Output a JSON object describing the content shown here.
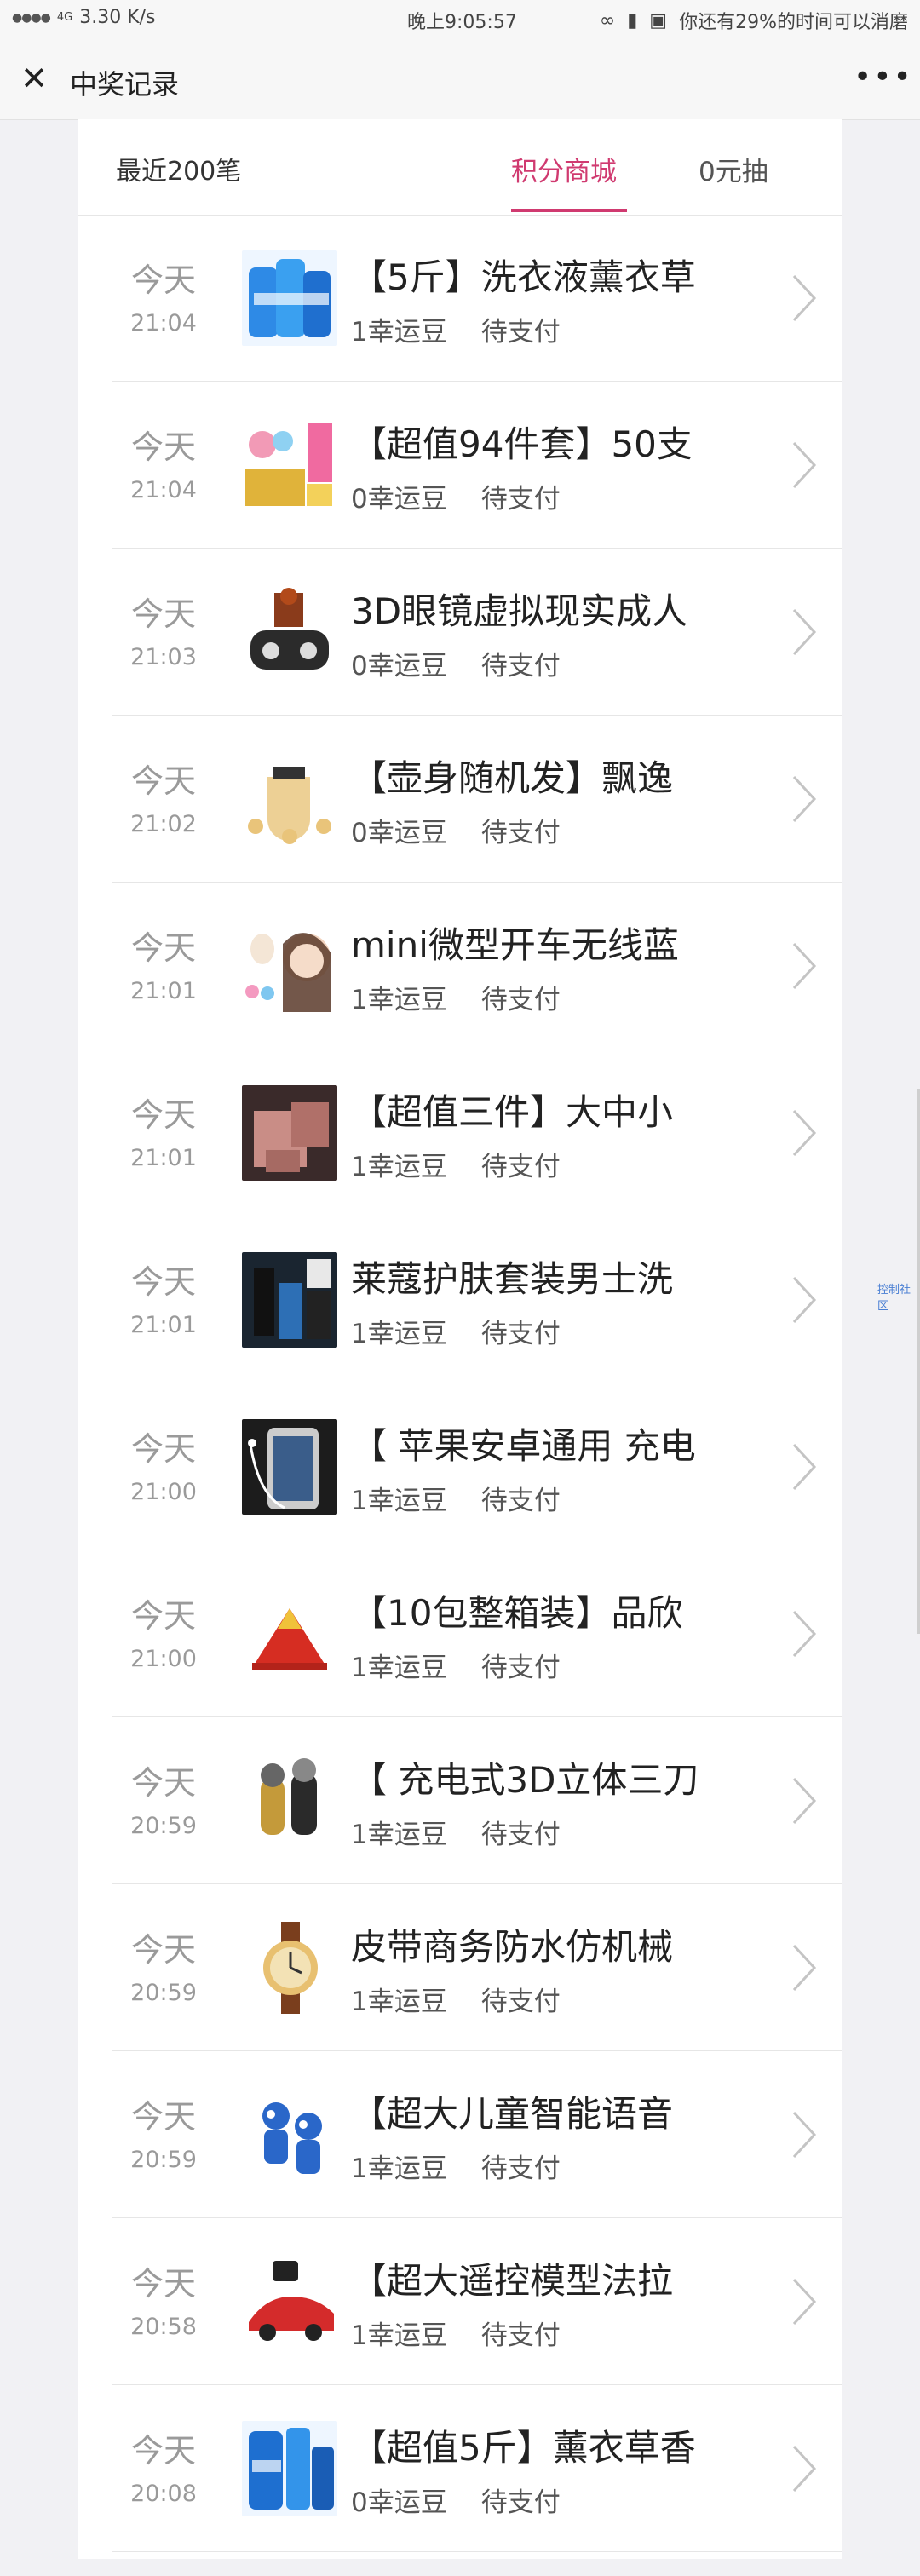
{
  "status_bar": {
    "network": "4G",
    "speed": "3.30 K/s",
    "time": "晚上9:05:57",
    "message": "你还有29%的时间可以消磨"
  },
  "title_bar": {
    "title": "中奖记录"
  },
  "tabs": {
    "recent": "最近200笔",
    "mall": "积分商城",
    "zero": "0元抽"
  },
  "side_link": "控制社区",
  "records": [
    {
      "day": "今天",
      "time": "21:04",
      "name": "【5斤】洗衣液薰衣草",
      "cost": "1幸运豆",
      "status": "待支付"
    },
    {
      "day": "今天",
      "time": "21:04",
      "name": "【超值94件套】50支",
      "cost": "0幸运豆",
      "status": "待支付"
    },
    {
      "day": "今天",
      "time": "21:03",
      "name": "3D眼镜虚拟现实成人",
      "cost": "0幸运豆",
      "status": "待支付"
    },
    {
      "day": "今天",
      "time": "21:02",
      "name": "【壶身随机发】飘逸",
      "cost": "0幸运豆",
      "status": "待支付"
    },
    {
      "day": "今天",
      "time": "21:01",
      "name": "mini微型开车无线蓝",
      "cost": "1幸运豆",
      "status": "待支付"
    },
    {
      "day": "今天",
      "time": "21:01",
      "name": "【超值三件】大中小",
      "cost": "1幸运豆",
      "status": "待支付"
    },
    {
      "day": "今天",
      "time": "21:01",
      "name": "莱蔻护肤套装男士洗",
      "cost": "1幸运豆",
      "status": "待支付"
    },
    {
      "day": "今天",
      "time": "21:00",
      "name": "【 苹果安卓通用 充电",
      "cost": "1幸运豆",
      "status": "待支付"
    },
    {
      "day": "今天",
      "time": "21:00",
      "name": "【10包整箱装】品欣",
      "cost": "1幸运豆",
      "status": "待支付"
    },
    {
      "day": "今天",
      "time": "20:59",
      "name": "【 充电式3D立体三刀",
      "cost": "1幸运豆",
      "status": "待支付"
    },
    {
      "day": "今天",
      "time": "20:59",
      "name": "皮带商务防水仿机械",
      "cost": "1幸运豆",
      "status": "待支付"
    },
    {
      "day": "今天",
      "time": "20:59",
      "name": "【超大儿童智能语音",
      "cost": "1幸运豆",
      "status": "待支付"
    },
    {
      "day": "今天",
      "time": "20:58",
      "name": "【超大遥控模型法拉",
      "cost": "1幸运豆",
      "status": "待支付"
    },
    {
      "day": "今天",
      "time": "20:08",
      "name": "【超值5斤】薰衣草香",
      "cost": "0幸运豆",
      "status": "待支付"
    }
  ]
}
